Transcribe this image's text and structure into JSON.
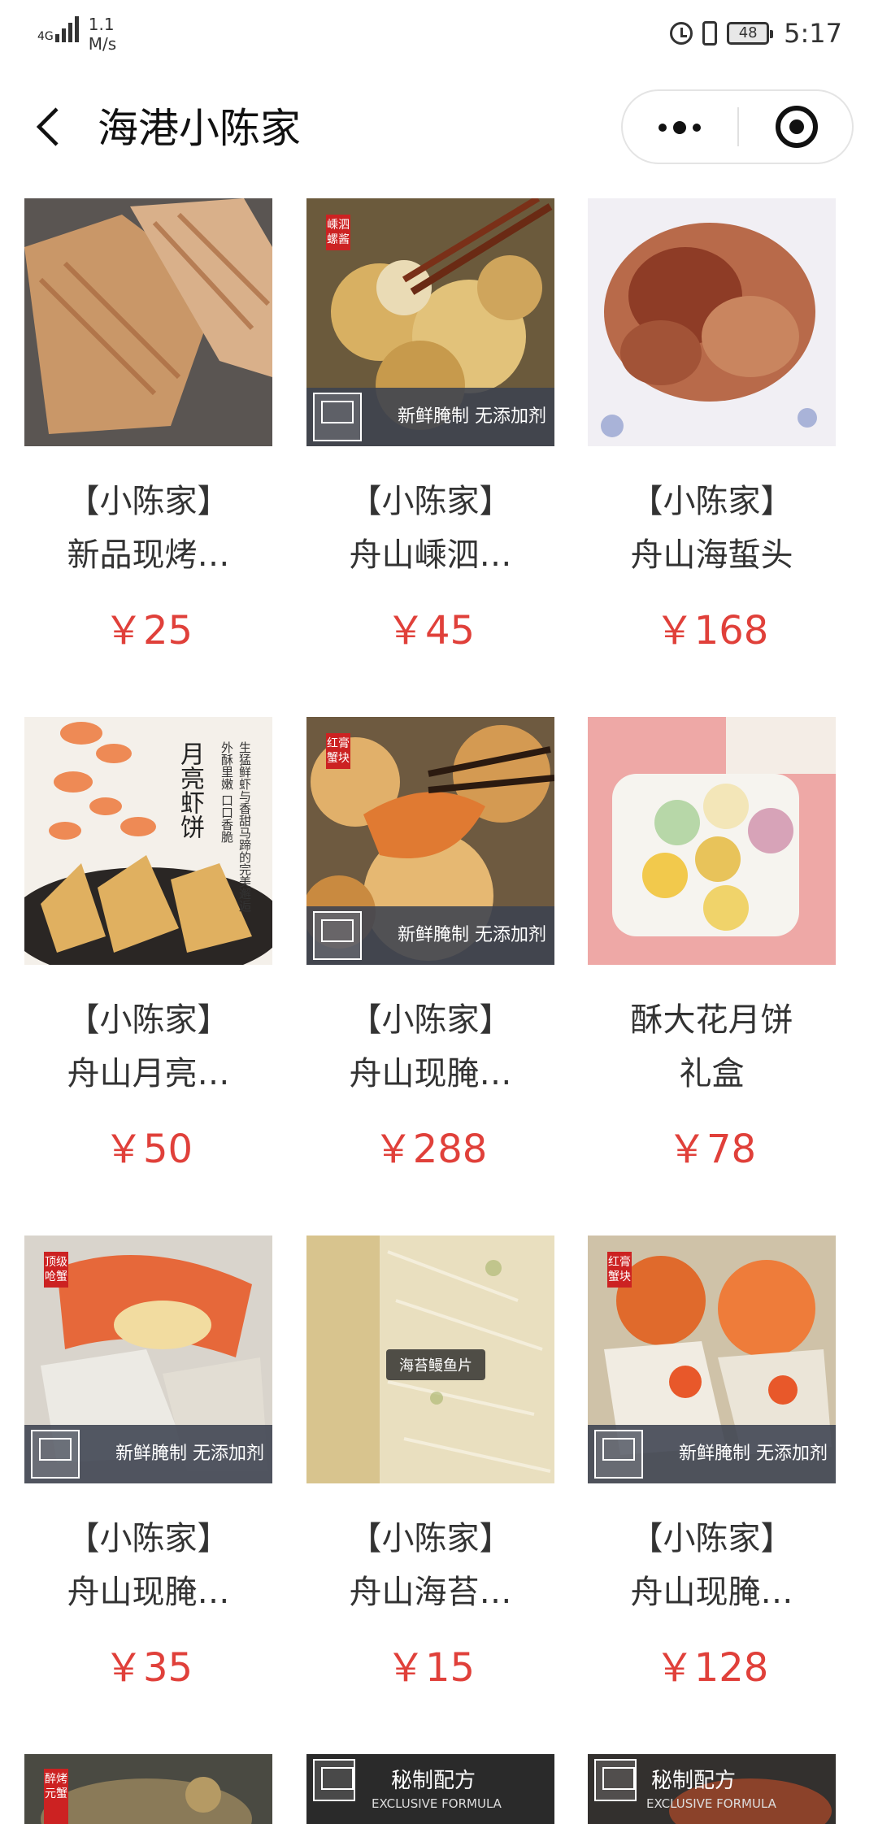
{
  "status_bar": {
    "network": "4G",
    "speed_value": "1.1",
    "speed_unit": "M/s",
    "battery": "48",
    "time": "5:17"
  },
  "nav": {
    "title": "海港小陈家"
  },
  "products": [
    {
      "line1": "【小陈家】",
      "line2": "新品现烤…",
      "price": "￥25"
    },
    {
      "line1": "【小陈家】",
      "line2": "舟山嵊泗…",
      "price": "￥45",
      "tag": "嵊泗螺酱",
      "banner": "新鲜腌制 无添加剂"
    },
    {
      "line1": "【小陈家】",
      "line2": "舟山海蜇头",
      "price": "￥168"
    },
    {
      "line1": "【小陈家】",
      "line2": "舟山月亮…",
      "price": "￥50",
      "overlay_title": "月亮虾饼",
      "overlay_text_1": "生猛鲜虾与香甜马蹄的完美邂逅",
      "overlay_text_2": "外酥里嫩 口口香脆"
    },
    {
      "line1": "【小陈家】",
      "line2": "舟山现腌…",
      "price": "￥288",
      "tag": "红膏蟹块",
      "banner": "新鲜腌制 无添加剂"
    },
    {
      "line1": "酥大花月饼",
      "line2": "礼盒",
      "price": "￥78"
    },
    {
      "line1": "【小陈家】",
      "line2": "舟山现腌…",
      "price": "￥35",
      "tag": "顶级呛蟹",
      "banner": "新鲜腌制 无添加剂"
    },
    {
      "line1": "【小陈家】",
      "line2": "舟山海苔…",
      "price": "￥15",
      "pill": "海苔鳗鱼片"
    },
    {
      "line1": "【小陈家】",
      "line2": "舟山现腌…",
      "price": "￥128",
      "tag": "红膏蟹块",
      "banner": "新鲜腌制 无添加剂"
    },
    {
      "tag": "醉烤元蟹"
    },
    {
      "secret": "秘制配方",
      "secret_en": "EXCLUSIVE FORMULA"
    },
    {
      "secret": "秘制配方",
      "secret_en": "EXCLUSIVE FORMULA"
    }
  ]
}
